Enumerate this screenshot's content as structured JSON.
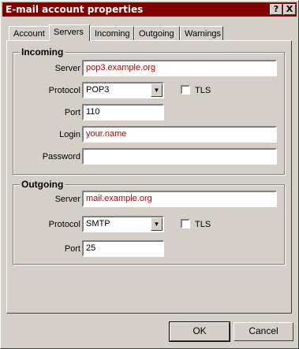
{
  "window": {
    "title": "E-mail account properties",
    "help_label": "?",
    "close_label": "X"
  },
  "tabs": [
    {
      "label": "Account"
    },
    {
      "label": "Servers",
      "active": true
    },
    {
      "label": "Incoming"
    },
    {
      "label": "Outgoing"
    },
    {
      "label": "Warnings"
    }
  ],
  "incoming": {
    "title": "Incoming",
    "server_label": "Server",
    "server_value": "pop3.example.org",
    "protocol_label": "Protocol",
    "protocol_value": "POP3",
    "tls_label": "TLS",
    "port_label": "Port",
    "port_value": "110",
    "login_label": "Login",
    "login_value": "your.name",
    "password_label": "Password",
    "password_value": ""
  },
  "outgoing": {
    "title": "Outgoing",
    "server_label": "Server",
    "server_value": "mail.example.org",
    "protocol_label": "Protocol",
    "protocol_value": "SMTP",
    "tls_label": "TLS",
    "port_label": "Port",
    "port_value": "25"
  },
  "buttons": {
    "ok": "OK",
    "cancel": "Cancel"
  },
  "colors": {
    "titlebar": "#800000",
    "field_text": "#c00000",
    "face": "#d4d0c8"
  }
}
